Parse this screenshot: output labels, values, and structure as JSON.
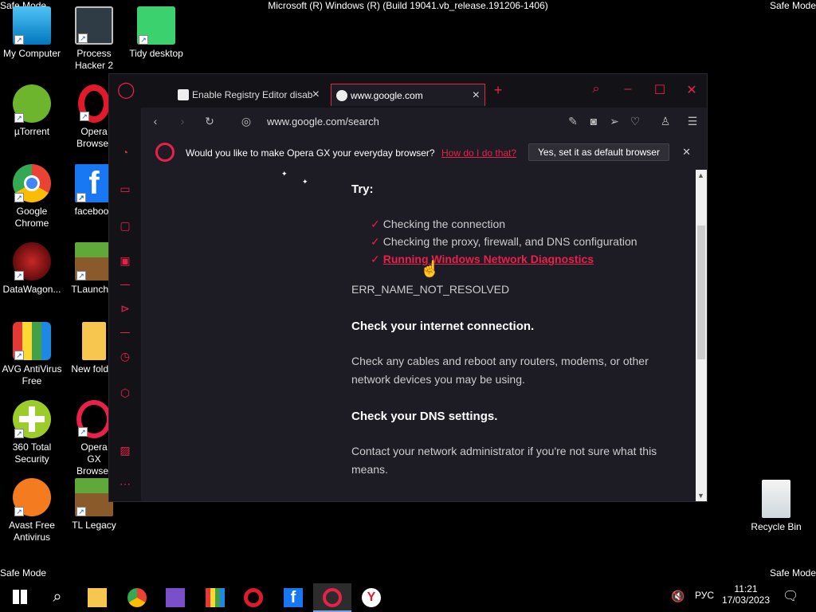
{
  "system": {
    "title": "Microsoft (R) Windows (R) (Build 19041.vb_release.191206-1406)",
    "safe_mode": "Safe Mode"
  },
  "desktop_icons": [
    {
      "label": "My Computer",
      "icon": "computer-icon"
    },
    {
      "label": "Process Hacker 2",
      "icon": "process-hacker-icon"
    },
    {
      "label": "Tidy desktop",
      "icon": "tidy-desktop-icon"
    },
    {
      "label": "µTorrent",
      "icon": "utorrent-icon"
    },
    {
      "label": "Opera Browser",
      "icon": "opera-icon"
    },
    {
      "label": "Google Chrome",
      "icon": "chrome-icon"
    },
    {
      "label": "facebook",
      "icon": "facebook-icon"
    },
    {
      "label": "DataWagon...",
      "icon": "datawagon-icon"
    },
    {
      "label": "TLauncher",
      "icon": "tlauncher-icon"
    },
    {
      "label": "AVG AntiVirus Free",
      "icon": "avg-icon"
    },
    {
      "label": "New folder",
      "icon": "folder-icon"
    },
    {
      "label": "360 Total Security",
      "icon": "360-security-icon"
    },
    {
      "label": "Opera GX Browser",
      "icon": "opera-gx-icon"
    },
    {
      "label": "Avast Free Antivirus",
      "icon": "avast-icon"
    },
    {
      "label": "TL Legacy",
      "icon": "tl-legacy-icon"
    },
    {
      "label": "Recycle Bin",
      "icon": "recycle-bin-icon"
    }
  ],
  "browser": {
    "tabs": [
      {
        "label": "Enable Registry Editor disab"
      },
      {
        "label": "www.google.com"
      }
    ],
    "url": "www.google.com/search",
    "infobar": {
      "text": "Would you like to make Opera GX your everyday browser?",
      "link": "How do I do that?",
      "button": "Yes, set it as default browser"
    },
    "page": {
      "try_label": "Try:",
      "suggestions": [
        "Checking the connection",
        "Checking the proxy, firewall, and DNS configuration",
        "Running Windows Network Diagnostics"
      ],
      "error_code": "ERR_NAME_NOT_RESOLVED",
      "h1": "Check your internet connection.",
      "p1a": "Check any cables and reboot any routers, modems, or other",
      "p1b": "network devices you may be using.",
      "h2": "Check your DNS settings.",
      "p2a": "Contact your network administrator if you're not sure what this",
      "p2b": "means."
    }
  },
  "taskbar": {
    "lang": "РУС",
    "time": "11:21",
    "date": "17/03/2023"
  },
  "colors": {
    "accent": "#e8204a",
    "background": "#1d1c24"
  }
}
